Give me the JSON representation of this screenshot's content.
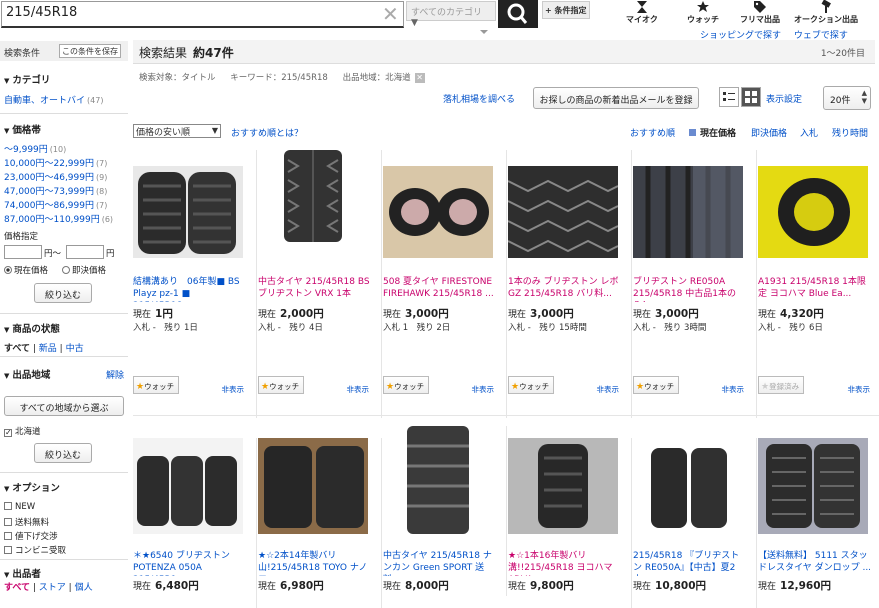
{
  "header": {
    "search_value": "215/45R18",
    "category_placeholder": "すべてのカテゴリ",
    "conditions_button": "+ 条件指定",
    "nav": [
      "マイオク",
      "ウォッチ",
      "フリマ出品",
      "オークション出品"
    ],
    "sublinks": [
      "ショッピングで探す",
      "ウェブで探す"
    ]
  },
  "sidebar": {
    "search_conditions": "検索条件",
    "save_condition": "この条件を保存",
    "category_title": "カテゴリ",
    "category_link": "自動車、オートバイ",
    "category_count": "(47)",
    "price_title": "価格帯",
    "price_ranges": [
      {
        "label": "～9,999円",
        "count": "(10)"
      },
      {
        "label": "10,000円～22,999円",
        "count": "(7)"
      },
      {
        "label": "23,000円～46,999円",
        "count": "(9)"
      },
      {
        "label": "47,000円～73,999円",
        "count": "(8)"
      },
      {
        "label": "74,000円～86,999円",
        "count": "(7)"
      },
      {
        "label": "87,000円～110,999円",
        "count": "(6)"
      }
    ],
    "price_specify": "価格指定",
    "yen_from": "円～",
    "yen_to": "円",
    "current_price": "現在価格",
    "buyout_price": "即決価格",
    "narrow_button": "絞り込む",
    "condition_title": "商品の状態",
    "condition_all": "すべて",
    "condition_new": "新品",
    "condition_used": "中古",
    "region_title": "出品地域",
    "region_clear": "解除",
    "region_all_button": "すべての地域から選ぶ",
    "region_selected": "北海道",
    "options_title": "オプション",
    "options": [
      "NEW",
      "送料無料",
      "値下げ交渉",
      "コンビニ受取"
    ],
    "seller_title": "出品者",
    "seller_all": "すべて",
    "seller_store": "ストア",
    "seller_individual": "個人"
  },
  "main": {
    "results_label": "検索結果",
    "results_count": "約47件",
    "results_range": "1～20件目",
    "filter_target": "検索対象：タイトル",
    "filter_keyword": "キーワード：215/45R18",
    "filter_region": "出品地域：北海道",
    "market_link": "落札相場を調べる",
    "mail_button": "お探しの商品の新着出品メールを登録",
    "display_settings": "表示設定",
    "per_page": "20件",
    "sort_select": "価格の安い順",
    "recommend_link": "おすすめ順とは？",
    "sort_options": [
      "おすすめ順",
      "現在価格",
      "即決価格",
      "入札",
      "残り時間"
    ],
    "row1": [
      {
        "title": "結構溝あり　06年製■ BS Playz pz-1 ■ 215/45R18...",
        "red": false,
        "price": "1円",
        "bids": "入札 -",
        "remain": "残り 1日",
        "watch": "ウォッチ"
      },
      {
        "title": "中古タイヤ 215/45R18 BS ブリヂストン VRX 1本",
        "red": true,
        "price": "2,000円",
        "bids": "入札 -",
        "remain": "残り 4日",
        "watch": "ウォッチ"
      },
      {
        "title": "508 夏タイヤ FIRESTONE FIREHAWK 215/45R18 ...",
        "red": true,
        "price": "3,000円",
        "bids": "入札 1",
        "remain": "残り 2日",
        "watch": "ウォッチ"
      },
      {
        "title": "1本のみ ブリヂストン レボGZ 215/45R18 バリ料...",
        "red": true,
        "price": "3,000円",
        "bids": "入札 -",
        "remain": "残り 15時間",
        "watch": "ウォッチ"
      },
      {
        "title": "ブリヂストン RE050A 215/45R18 中古品1本のみ！...",
        "red": true,
        "price": "3,000円",
        "bids": "入札 -",
        "remain": "残り 3時間",
        "watch": "ウォッチ"
      },
      {
        "title": "A1931 215/45R18 1本限定 ヨコハマ Blue Ea...",
        "red": true,
        "price": "4,320円",
        "bids": "入札 -",
        "remain": "残り 6日",
        "watch": "登録済み"
      }
    ],
    "row2": [
      {
        "title": "＊★6540 ブリヂストン POTENZA 050A 215/45R1...",
        "red": false,
        "price": "6,480円"
      },
      {
        "title": "★☆2本14年製バリ山!215/45R18 TOYO ナノエ...",
        "red": false,
        "price": "6,980円"
      },
      {
        "title": "中古タイヤ 215/45R18 ナンカン Green SPORT 送料...",
        "red": false,
        "price": "8,000円"
      },
      {
        "title": "★☆1本16年製バリ溝!!215/45R18 ヨコハマ ADVA...",
        "red": true,
        "price": "9,800円"
      },
      {
        "title": "215/45R18 『ブリヂストン RE050A』【中古】夏2本...",
        "red": false,
        "price": "10,800円"
      },
      {
        "title": "【送料無料】 5111 スタッドレスタイヤ ダンロップ ...",
        "red": false,
        "price": "12,960円"
      }
    ],
    "current_label": "現在",
    "hide_label": "非表示"
  }
}
